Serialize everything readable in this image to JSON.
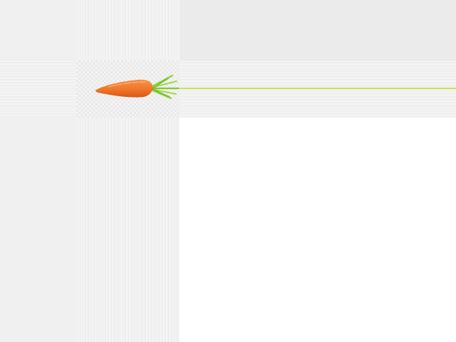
{
  "progress": {
    "fraction": 1.0,
    "color": "#c8e05a"
  },
  "icon": {
    "name": "carrot-icon",
    "body_color": "#f07a2a",
    "leaf_color": "#8fd13a"
  },
  "colors": {
    "background": "#ffffff",
    "panel_gray": "#ebebeb"
  }
}
